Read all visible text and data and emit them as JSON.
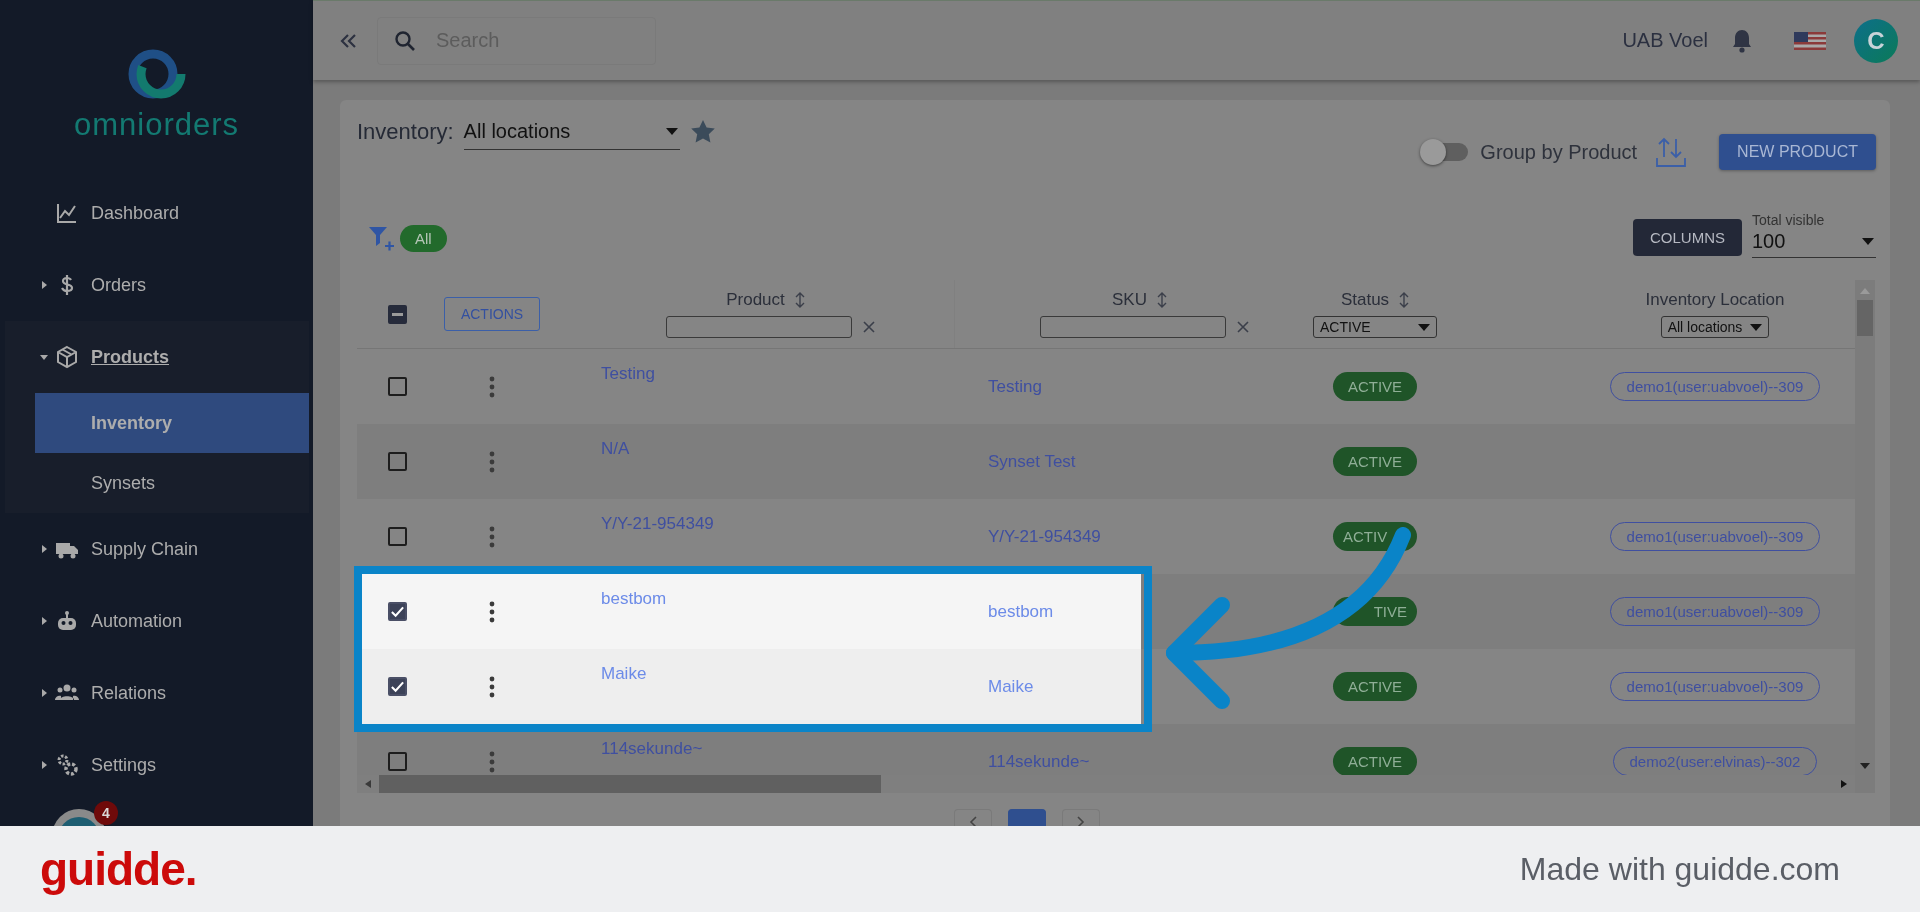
{
  "sidebar": {
    "logo_text": "omniorders",
    "items": [
      {
        "label": "Dashboard",
        "kind": "link",
        "selected": false
      },
      {
        "label": "Orders",
        "kind": "group",
        "expanded": false,
        "selected": false
      },
      {
        "label": "Products",
        "kind": "group",
        "expanded": true,
        "selected": true,
        "children": [
          {
            "label": "Inventory",
            "selected": true
          },
          {
            "label": "Synsets",
            "selected": false
          }
        ]
      },
      {
        "label": "Supply Chain",
        "kind": "group",
        "expanded": false,
        "selected": false
      },
      {
        "label": "Automation",
        "kind": "group",
        "expanded": false,
        "selected": false
      },
      {
        "label": "Relations",
        "kind": "group",
        "expanded": false,
        "selected": false
      },
      {
        "label": "Settings",
        "kind": "group",
        "expanded": false,
        "selected": false
      }
    ],
    "assistant_badge": "4"
  },
  "topbar": {
    "search_placeholder": "Search",
    "company": "UAB Voel",
    "avatar_letter": "C"
  },
  "page": {
    "title": "Inventory:",
    "location": "All locations",
    "group_toggle": {
      "label": "Group by Product",
      "on": false
    },
    "new_button": "NEW PRODUCT",
    "filter_chip": "All",
    "columns_button": "COLUMNS",
    "total_visible": {
      "label": "Total visible",
      "value": "100"
    }
  },
  "table": {
    "actions_button": "ACTIONS",
    "select_all_partial": true,
    "columns": [
      {
        "label": "Product",
        "kind": "text"
      },
      {
        "label": "SKU",
        "kind": "text"
      },
      {
        "label": "Status",
        "kind": "select",
        "value": "ACTIVE"
      },
      {
        "label": "Inventory Location",
        "kind": "select",
        "value": "All locations"
      }
    ],
    "rows": [
      {
        "product": "Testing",
        "sku": "Testing",
        "status": "ACTIVE",
        "location": "demo1(user:uabvoel)--309",
        "checked": false,
        "highlighted": false
      },
      {
        "product": "N/A",
        "sku": "Synset Test",
        "status": "ACTIVE",
        "checked": false,
        "highlighted": false
      },
      {
        "product": "Y/Y-21-954349",
        "sku": "Y/Y-21-954349",
        "status": "ACTIV",
        "kind": "tailcut",
        "location": "demo1(user:uabvoel)--309",
        "checked": false,
        "highlighted": false
      },
      {
        "product": "bestbom",
        "sku": "bestbom",
        "status": "TIVE",
        "kind": "headcut",
        "location": "demo1(user:uabvoel)--309",
        "checked": true,
        "highlighted": true
      },
      {
        "product": "Maike",
        "sku": "Maike",
        "status": "ACTIVE",
        "location": "demo1(user:uabvoel)--309",
        "checked": true,
        "highlighted": true
      },
      {
        "product": "114sekunde~",
        "sku": "114sekunde~",
        "status": "ACTIVE",
        "location": "demo2(user:elvinas)--302",
        "checked": false,
        "highlighted": false
      }
    ]
  },
  "footer": {
    "brand": "guidde.",
    "credit": "Made with guidde.com"
  }
}
